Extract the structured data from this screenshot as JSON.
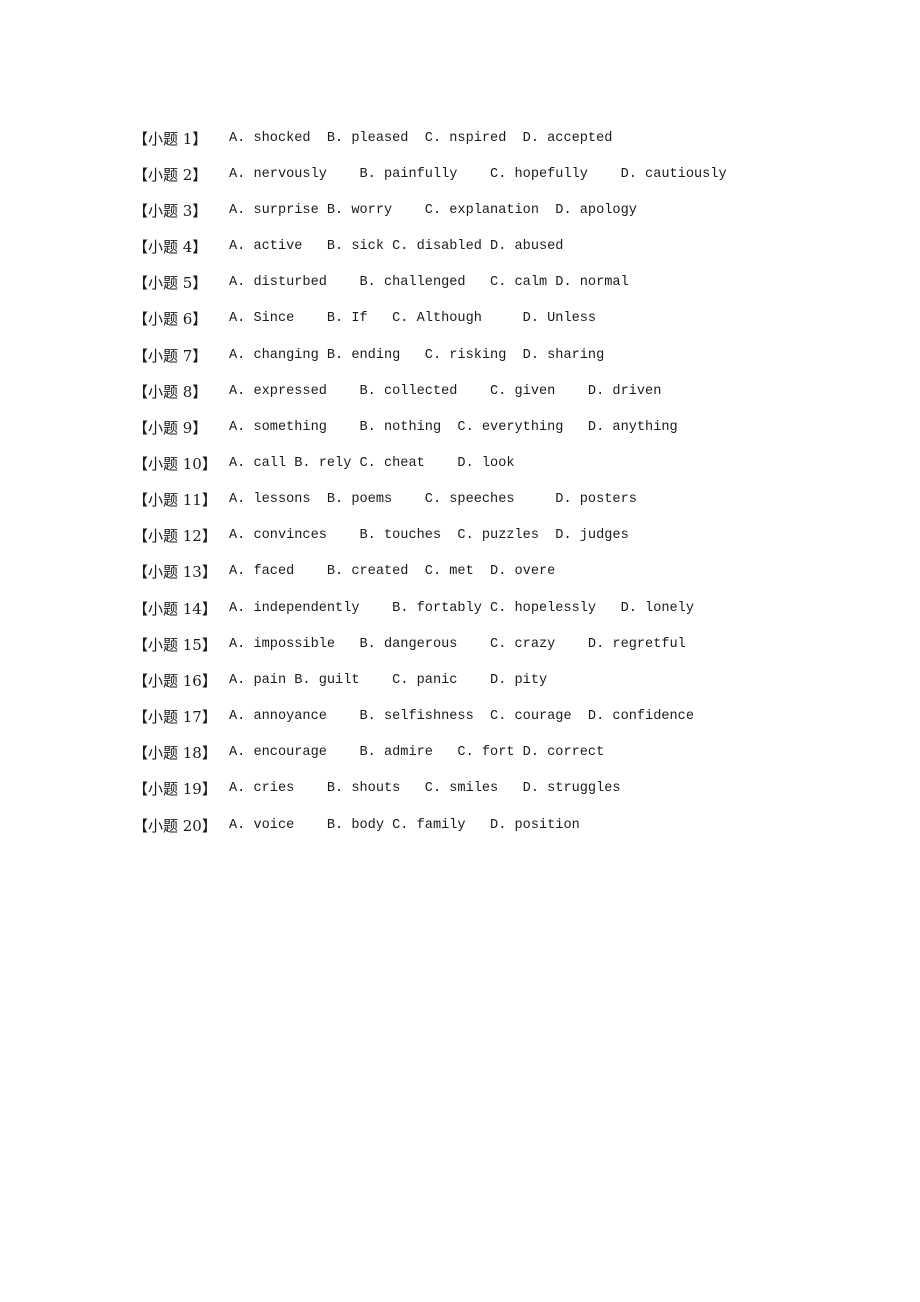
{
  "questions": [
    {
      "label": "【小题 1】",
      "options": "A. shocked  B. pleased  C. nspired  D. accepted"
    },
    {
      "label": "【小题 2】",
      "options": "A. nervously    B. painfully    C. hopefully    D. cautiously"
    },
    {
      "label": "【小题 3】",
      "options": "A. surprise B. worry    C. explanation  D. apology"
    },
    {
      "label": "【小题 4】",
      "options": "A. active   B. sick C. disabled D. abused"
    },
    {
      "label": "【小题 5】",
      "options": "A. disturbed    B. challenged   C. calm D. normal"
    },
    {
      "label": "【小题 6】",
      "options": "A. Since    B. If   C. Although     D. Unless"
    },
    {
      "label": "【小题 7】",
      "options": "A. changing B. ending   C. risking  D. sharing"
    },
    {
      "label": "【小题 8】",
      "options": "A. expressed    B. collected    C. given    D. driven"
    },
    {
      "label": "【小题 9】",
      "options": "A. something    B. nothing  C. everything   D. anything"
    },
    {
      "label": "【小题 10】",
      "options": "A. call B. rely C. cheat    D. look"
    },
    {
      "label": "【小题 11】",
      "options": "A. lessons  B. poems    C. speeches     D. posters"
    },
    {
      "label": "【小题 12】",
      "options": "A. convinces    B. touches  C. puzzles  D. judges"
    },
    {
      "label": "【小题 13】",
      "options": "A. faced    B. created  C. met  D. overe"
    },
    {
      "label": "【小题 14】",
      "options": "A. independently    B. fortably C. hopelessly   D. lonely"
    },
    {
      "label": "【小题 15】",
      "options": "A. impossible   B. dangerous    C. crazy    D. regretful"
    },
    {
      "label": "【小题 16】",
      "options": "A. pain B. guilt    C. panic    D. pity"
    },
    {
      "label": "【小题 17】",
      "options": "A. annoyance    B. selfishness  C. courage  D. confidence"
    },
    {
      "label": "【小题 18】",
      "options": "A. encourage    B. admire   C. fort D. correct"
    },
    {
      "label": "【小题 19】",
      "options": "A. cries    B. shouts   C. smiles   D. struggles"
    },
    {
      "label": "【小题 20】",
      "options": "A. voice    B. body C. family   D. position"
    }
  ]
}
